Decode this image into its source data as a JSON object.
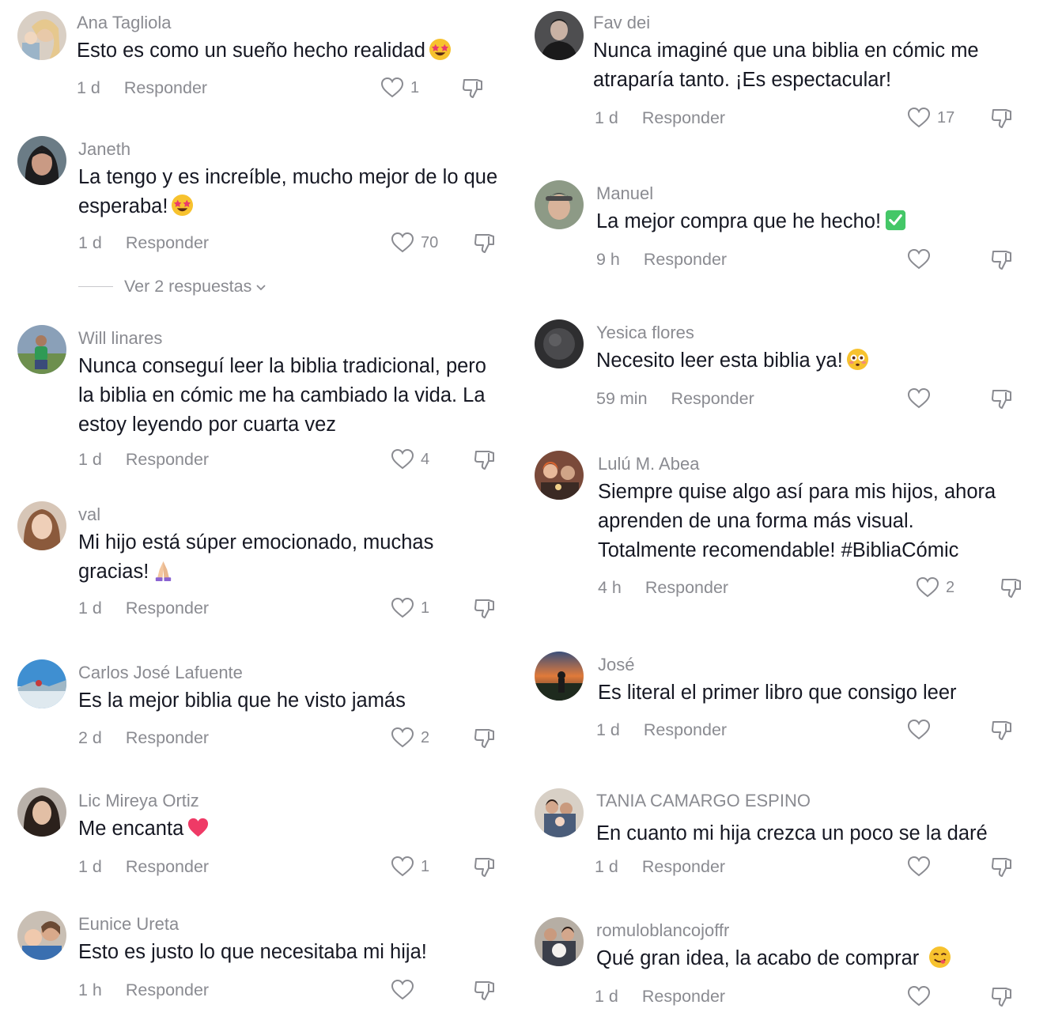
{
  "colors": {
    "text": "#161823",
    "muted": "#8a8b91",
    "background": "#ffffff"
  },
  "labels": {
    "reply": "Responder"
  },
  "comments": [
    {
      "id": "c1",
      "username": "Ana Tagliola",
      "text": "Esto es como un sueño hecho realidad",
      "emoji": "star-struck-icon",
      "time": "1 d",
      "likes": "1",
      "avatar": "ana"
    },
    {
      "id": "c2",
      "username": "Janeth",
      "text": "La tengo y es increíble, mucho mejor de lo que esperaba!",
      "emoji": "star-struck-icon",
      "time": "1 d",
      "likes": "70",
      "view_replies": "Ver 2 respuestas",
      "avatar": "janeth"
    },
    {
      "id": "c3",
      "username": "Will linares",
      "text": "Nunca conseguí leer la biblia tradicional, pero la biblia en cómic me ha cambiado la vida. La estoy leyendo por cuarta vez",
      "time": "1 d",
      "likes": "4",
      "avatar": "will"
    },
    {
      "id": "c4",
      "username": "val",
      "text": "Mi hijo está súper emocionado, muchas gracias!",
      "emoji": "folded-hands-icon",
      "time": "1 d",
      "likes": "1",
      "avatar": "val"
    },
    {
      "id": "c5",
      "username": "Carlos José Lafuente",
      "text": "Es la mejor biblia que he visto jamás",
      "time": "2 d",
      "likes": "2",
      "avatar": "carlos"
    },
    {
      "id": "c6",
      "username": "Lic Mireya Ortiz",
      "text": "Me encanta",
      "emoji": "heart-icon",
      "time": "1 d",
      "likes": "1",
      "avatar": "mireya"
    },
    {
      "id": "c7",
      "username": "Eunice Ureta",
      "text": "Esto es justo lo que necesitaba mi hija!",
      "time": "1 h",
      "likes": "",
      "avatar": "eunice"
    },
    {
      "id": "c8",
      "username": "Fav dei",
      "text": "Nunca imaginé que una biblia en cómic me atraparía tanto. ¡Es espectacular!",
      "time": "1 d",
      "likes": "17",
      "avatar": "fav"
    },
    {
      "id": "c9",
      "username": "Manuel",
      "text": "La mejor compra que he hecho!",
      "emoji": "check-mark-icon",
      "time": "9 h",
      "likes": "",
      "avatar": "manuel"
    },
    {
      "id": "c10",
      "username": "Yesica flores",
      "text": "Necesito leer esta biblia ya!",
      "emoji": "flushed-face-icon",
      "time": "59 min",
      "likes": "",
      "avatar": "yesica"
    },
    {
      "id": "c11",
      "username": "Lulú M. Abea",
      "text": "Siempre quise algo así para mis hijos, ahora aprenden de una forma más visual. Totalmente recomendable! #BibliaCómic",
      "time": "4 h",
      "likes": "2",
      "avatar": "lulu"
    },
    {
      "id": "c12",
      "username": "José",
      "text": "Es literal el primer libro que consigo leer",
      "time": "1 d",
      "likes": "",
      "avatar": "jose"
    },
    {
      "id": "c13",
      "username": "TANIA CAMARGO ESPINO",
      "text": "En cuanto mi hija crezca un poco se la daré",
      "time": "1 d",
      "likes": "",
      "avatar": "tania"
    },
    {
      "id": "c14",
      "username": "romuloblancojoffr",
      "text": "Qué gran idea, la acabo de comprar",
      "emoji": "yum-face-icon",
      "time": "1 d",
      "likes": "",
      "avatar": "romulo"
    }
  ]
}
